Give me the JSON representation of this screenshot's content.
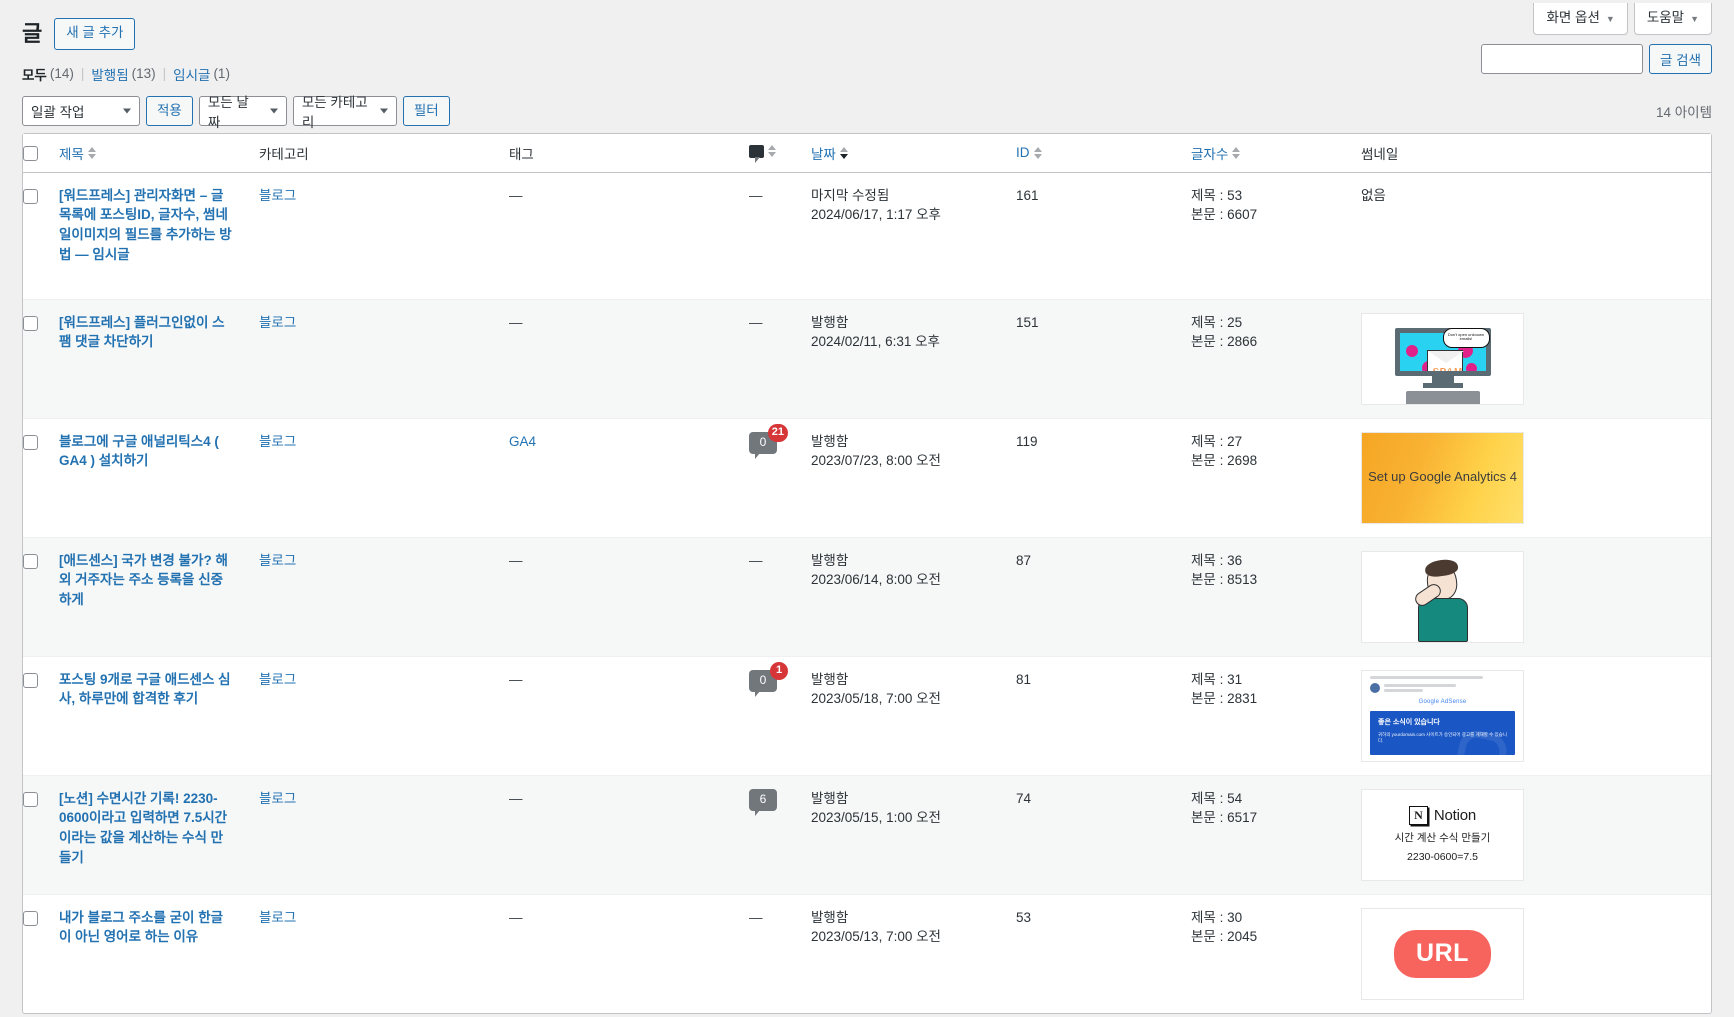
{
  "screen_meta": {
    "screen_options": "화면 옵션",
    "help": "도움말"
  },
  "header": {
    "title": "글",
    "add_new": "새 글 추가"
  },
  "status_links": [
    {
      "label": "모두",
      "count": "(14)",
      "current": true
    },
    {
      "label": "발행됨",
      "count": "(13)",
      "current": false
    },
    {
      "label": "임시글",
      "count": "(1)",
      "current": false
    }
  ],
  "search": {
    "value": "",
    "placeholder": "",
    "submit": "글 검색"
  },
  "tablenav": {
    "bulk_actions": "일괄 작업",
    "apply": "적용",
    "all_dates": "모든 날짜",
    "all_categories": "모든 카테고리",
    "filter": "필터",
    "displaying_num": "14 아이템"
  },
  "columns": {
    "title": "제목",
    "category": "카테고리",
    "tag": "태그",
    "comments": "comment-icon",
    "date": "날짜",
    "id": "ID",
    "charcount": "글자수",
    "thumbnail": "썸네일"
  },
  "rows": [
    {
      "title": "[워드프레스] 관리자화면 – 글 목록에 포스팅ID, 글자수, 썸네일이미지의 필드를 추가하는 방법 — 임시글",
      "category": "블로그",
      "tag": "—",
      "comments": null,
      "comments_dash": "—",
      "date_status": "마지막 수정됨",
      "date_value": "2024/06/17, 1:17 오후",
      "id": "161",
      "count_title": "제목 : 53",
      "count_body": "본문 : 6607",
      "thumb_type": "none",
      "thumb_text": "없음"
    },
    {
      "title": "[워드프레스] 플러그인없이 스팸 댓글 차단하기",
      "category": "블로그",
      "tag": "—",
      "comments": null,
      "comments_dash": "—",
      "date_status": "발행함",
      "date_value": "2024/02/11, 6:31 오후",
      "id": "151",
      "count_title": "제목 : 25",
      "count_body": "본문 : 2866",
      "thumb_type": "spam",
      "thumb_text": ""
    },
    {
      "title": "블로그에 구글 애널리틱스4 ( GA4 ) 설치하기",
      "category": "블로그",
      "tag": "GA4",
      "comments": "0",
      "comments_badge": "21",
      "comments_dash": null,
      "date_status": "발행함",
      "date_value": "2023/07/23, 8:00 오전",
      "id": "119",
      "count_title": "제목 : 27",
      "count_body": "본문 : 2698",
      "thumb_type": "ga4",
      "thumb_text": "Set up Google Analytics 4"
    },
    {
      "title": "[애드센스] 국가 변경 불가? 해외 거주자는 주소 등록을 신중하게",
      "category": "블로그",
      "tag": "—",
      "comments": null,
      "comments_dash": "—",
      "date_status": "발행함",
      "date_value": "2023/06/14, 8:00 오전",
      "id": "87",
      "count_title": "제목 : 36",
      "count_body": "본문 : 8513",
      "thumb_type": "face",
      "thumb_text": ""
    },
    {
      "title": "포스팅 9개로 구글 애드센스 심사, 하루만에 합격한 후기",
      "category": "블로그",
      "tag": "—",
      "comments": "0",
      "comments_badge": "1",
      "comments_dash": null,
      "date_status": "발행함",
      "date_value": "2023/05/18, 7:00 오전",
      "id": "81",
      "count_title": "제목 : 31",
      "count_body": "본문 : 2831",
      "thumb_type": "adsense",
      "thumb_text": "좋은 소식이 있습니다"
    },
    {
      "title": "[노션] 수면시간 기록! 2230-0600이라고 입력하면 7.5시간이라는 값을 계산하는 수식 만들기",
      "category": "블로그",
      "tag": "—",
      "comments": "6",
      "comments_badge": null,
      "comments_dash": null,
      "date_status": "발행함",
      "date_value": "2023/05/15, 1:00 오전",
      "id": "74",
      "count_title": "제목 : 54",
      "count_body": "본문 : 6517",
      "thumb_type": "notion",
      "thumb_text": "Notion",
      "thumb_sub": "시간 계산 수식 만들기",
      "thumb_eq": "2230-0600=7.5"
    },
    {
      "title": "내가 블로그 주소를 굳이 한글이 아닌 영어로 하는 이유",
      "category": "블로그",
      "tag": "—",
      "comments": null,
      "comments_dash": "—",
      "date_status": "발행함",
      "date_value": "2023/05/13, 7:00 오전",
      "id": "53",
      "count_title": "제목 : 30",
      "count_body": "본문 : 2045",
      "thumb_type": "url",
      "thumb_text": "URL"
    }
  ],
  "thumb_details": {
    "spam_speech": "Don't open unknown emails!",
    "spam_word": "SPAM",
    "adsense_logo": "Google AdSense",
    "adsense_body": "귀하의 yourdomain.com 사이트가 승인되어 광고를 게재할 수 있습니다."
  },
  "colors": {
    "accent": "#2271b1",
    "badge_red": "#d63638",
    "bubble_gray": "#72777c",
    "page_bg": "#f0f0f1"
  }
}
